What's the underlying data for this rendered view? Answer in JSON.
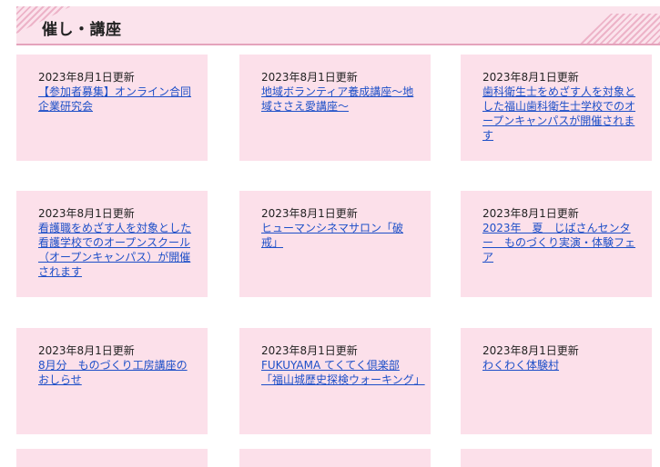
{
  "section": {
    "title": "催し・講座"
  },
  "cards": [
    {
      "date": "2023年8月1日更新",
      "title": "【参加者募集】オンライン合同企業研究会"
    },
    {
      "date": "2023年8月1日更新",
      "title": "地域ボランティア養成講座～地域ささえ愛講座～"
    },
    {
      "date": "2023年8月1日更新",
      "title": "歯科衛生士をめざす人を対象とした福山歯科衛生士学校でのオープンキャンパスが開催されます"
    },
    {
      "date": "2023年8月1日更新",
      "title": "看護職をめざす人を対象とした看護学校でのオープンスクール（オープンキャンパス）が開催されます"
    },
    {
      "date": "2023年8月1日更新",
      "title": "ヒューマンシネマサロン「破戒」"
    },
    {
      "date": "2023年8月1日更新",
      "title": "2023年　夏　じばさんセンター　ものづくり実演・体験フェア"
    },
    {
      "date": "2023年8月1日更新",
      "title": "8月分　ものづくり工房講座のおしらせ"
    },
    {
      "date": "2023年8月1日更新",
      "title": "FUKUYAMA てくてく倶楽部「福山城歴史探検ウォーキング」"
    },
    {
      "date": "2023年8月1日更新",
      "title": "わくわく体験村"
    }
  ]
}
